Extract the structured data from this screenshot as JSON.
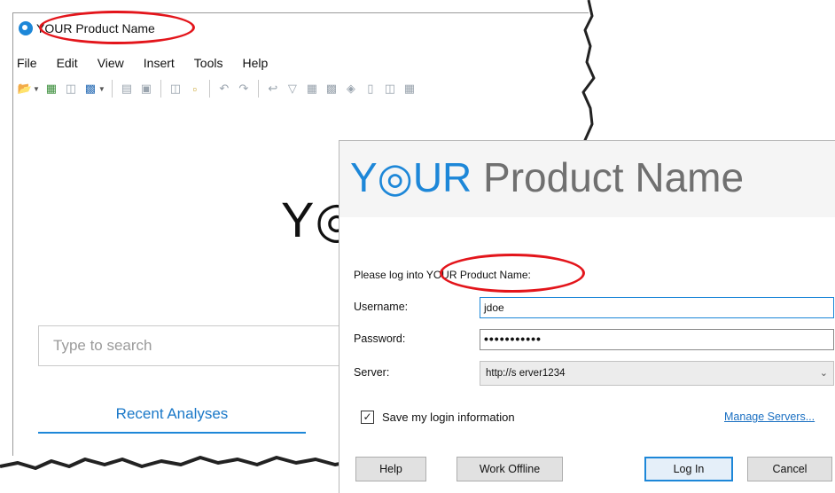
{
  "app": {
    "title": "YOUR Product Name",
    "menu": [
      "File",
      "Edit",
      "View",
      "Insert",
      "Tools",
      "Help"
    ],
    "toolbar_icons": [
      "open-folder-icon",
      "dropdown-arrow-icon",
      "add-data-icon",
      "copy-icon",
      "save-icon",
      "dropdown-arrow-icon",
      "print-icon",
      "preview-icon",
      "copy-icon",
      "paste-icon",
      "undo-icon",
      "redo-icon",
      "back-icon",
      "filter-icon",
      "table-icon",
      "chart-icon",
      "tag-icon",
      "book-icon",
      "layers-icon",
      "grid-icon"
    ],
    "big_logo_partial": "Y◎",
    "search_placeholder": "Type to search",
    "recent_tab": "Recent Analyses"
  },
  "dialog": {
    "title_brand": "Y◎UR",
    "title_rest": " Product Name",
    "prompt": "Please log into YOUR Product Name:",
    "username_label": "Username:",
    "username_value": "jdoe",
    "password_label": "Password:",
    "password_value": "•••••••••••",
    "server_label": "Server:",
    "server_value": "http://s erver1234",
    "save_login_label": "Save my login information",
    "save_login_checked": true,
    "manage_servers": "Manage Servers...",
    "buttons": {
      "help": "Help",
      "work_offline": "Work Offline",
      "login": "Log In",
      "cancel": "Cancel"
    }
  },
  "colors": {
    "brand_blue": "#1d87d8",
    "annotation_red": "#e3151b",
    "link_blue": "#1a6fc2"
  }
}
